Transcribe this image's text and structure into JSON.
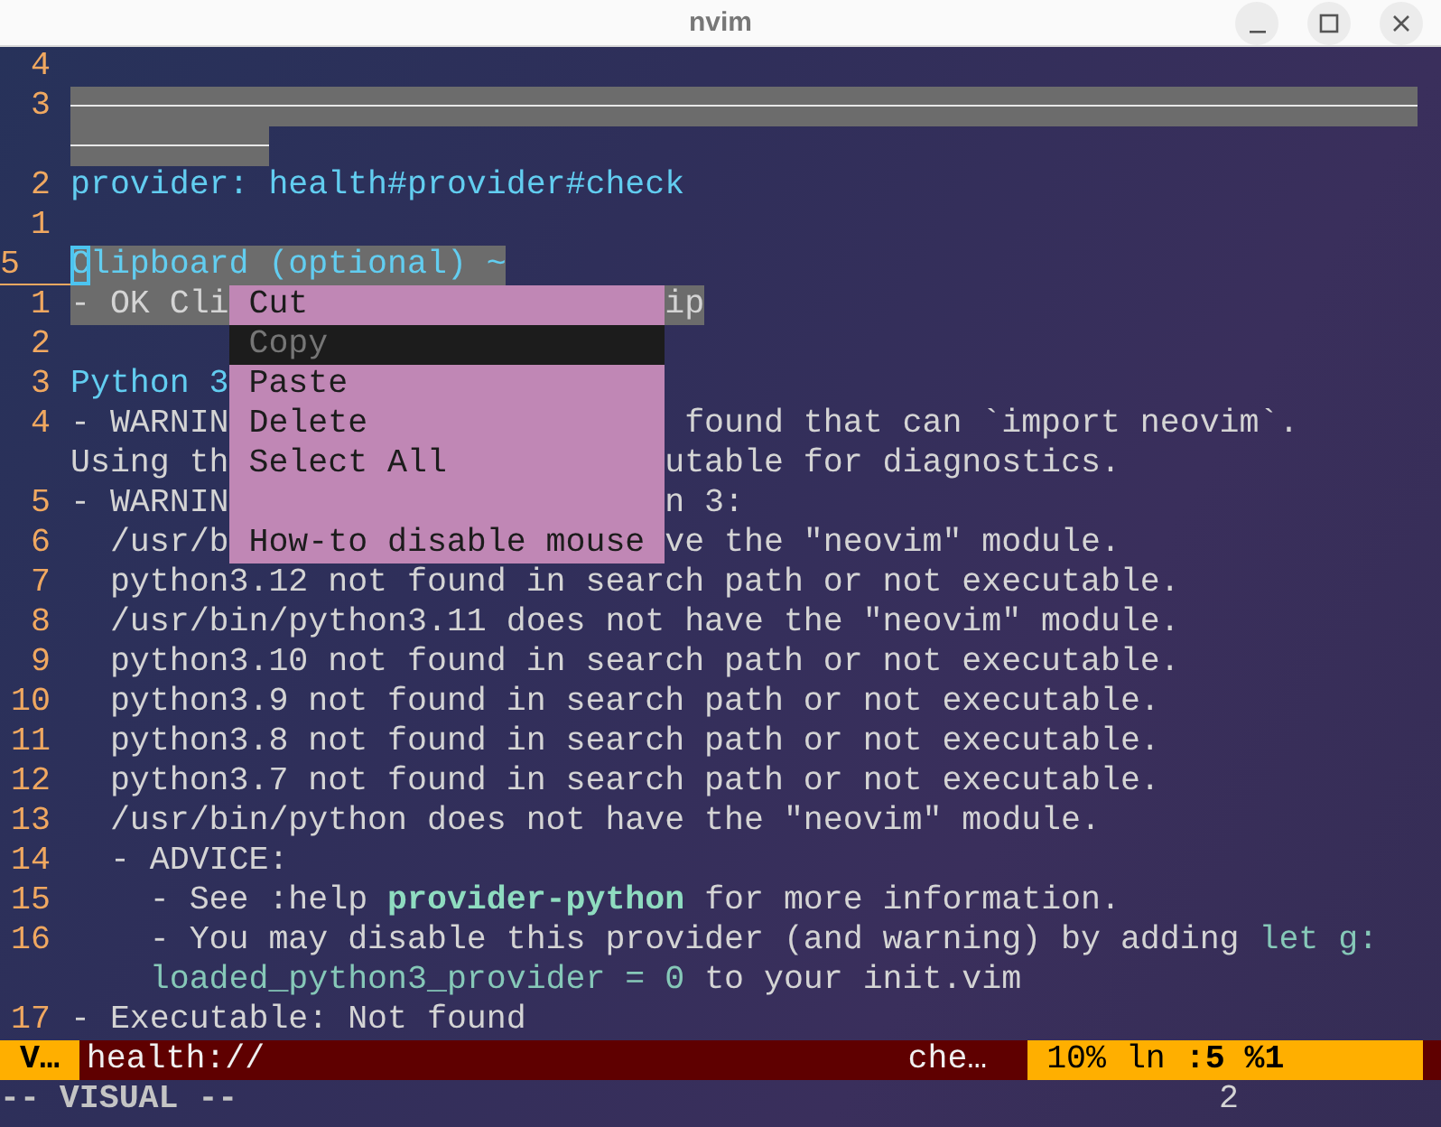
{
  "window": {
    "title": "nvim"
  },
  "lines": [
    {
      "num": "4"
    },
    {
      "num": "3",
      "kind": "rule",
      "selected": true
    },
    {
      "num": "2",
      "parts": [
        {
          "text": "provider: health#provider#check",
          "kind": "heading"
        }
      ]
    },
    {
      "num": "1"
    },
    {
      "num": "5",
      "current": true,
      "cursor": true,
      "selected": true,
      "parts": [
        {
          "text": "Clipboard (optional) ~",
          "kind": "heading"
        }
      ]
    },
    {
      "num": "1",
      "selected": true,
      "parts": [
        {
          "text": "- OK Cli",
          "kind": "plain"
        }
      ],
      "tail": [
        {
          "text": "ip",
          "kind": "plain"
        }
      ]
    },
    {
      "num": "2"
    },
    {
      "num": "3",
      "parts": [
        {
          "text": "Python 3",
          "kind": "heading"
        }
      ]
    },
    {
      "num": "4",
      "parts": [
        {
          "text": "- WARNIN",
          "kind": "plain"
        }
      ],
      "tail": [
        {
          "text": " found that can `import neovim`.",
          "kind": "plain"
        }
      ]
    },
    {
      "parts": [
        {
          "text": "Using th",
          "kind": "plain"
        }
      ],
      "tail": [
        {
          "text": "utable for diagnostics.",
          "kind": "plain"
        }
      ]
    },
    {
      "num": "5",
      "parts": [
        {
          "text": "- WARNIN",
          "kind": "plain"
        }
      ],
      "tail": [
        {
          "text": "n 3:",
          "kind": "plain"
        }
      ]
    },
    {
      "num": "6",
      "parts": [
        {
          "text": "  /usr/b",
          "kind": "plain"
        }
      ],
      "tail": [
        {
          "text": "ve the \"neovim\" module.",
          "kind": "plain"
        }
      ]
    },
    {
      "num": "7",
      "parts": [
        {
          "text": "  python3.12 not found in search path or not executable.",
          "kind": "plain"
        }
      ]
    },
    {
      "num": "8",
      "parts": [
        {
          "text": "  /usr/bin/python3.11 does not have the \"neovim\" module.",
          "kind": "plain"
        }
      ]
    },
    {
      "num": "9",
      "parts": [
        {
          "text": "  python3.10 not found in search path or not executable.",
          "kind": "plain"
        }
      ]
    },
    {
      "num": "10",
      "parts": [
        {
          "text": "  python3.9 not found in search path or not executable.",
          "kind": "plain"
        }
      ]
    },
    {
      "num": "11",
      "parts": [
        {
          "text": "  python3.8 not found in search path or not executable.",
          "kind": "plain"
        }
      ]
    },
    {
      "num": "12",
      "parts": [
        {
          "text": "  python3.7 not found in search path or not executable.",
          "kind": "plain"
        }
      ]
    },
    {
      "num": "13",
      "parts": [
        {
          "text": "  /usr/bin/python does not have the \"neovim\" module.",
          "kind": "plain"
        }
      ]
    },
    {
      "num": "14",
      "parts": [
        {
          "text": "  - ADVICE:",
          "kind": "plain"
        }
      ]
    },
    {
      "num": "15",
      "parts": [
        {
          "text": "    - See :help ",
          "kind": "plain"
        },
        {
          "text": "provider-python",
          "kind": "keyword"
        },
        {
          "text": " for more information.",
          "kind": "plain"
        }
      ]
    },
    {
      "num": "16",
      "parts": [
        {
          "text": "    - You may disable this provider (and warning) by adding ",
          "kind": "plain"
        },
        {
          "text": "let g:",
          "kind": "code"
        }
      ]
    },
    {
      "parts": [
        {
          "text": "    loaded_python3_provider = 0",
          "kind": "code"
        },
        {
          "text": " to your init.vim",
          "kind": "plain"
        }
      ]
    },
    {
      "num": "17",
      "parts": [
        {
          "text": "- Executable: Not found",
          "kind": "plain"
        }
      ]
    }
  ],
  "popup_menu": [
    {
      "kind": "item",
      "label": "Cut",
      "selected": false
    },
    {
      "kind": "item",
      "label": "Copy",
      "selected": true
    },
    {
      "kind": "item",
      "label": "Paste",
      "selected": false
    },
    {
      "kind": "item",
      "label": "Delete",
      "selected": false
    },
    {
      "kind": "item",
      "label": "Select All",
      "selected": false
    },
    {
      "kind": "separator"
    },
    {
      "kind": "item",
      "label": "How-to disable mouse",
      "selected": false
    }
  ],
  "status_bar": {
    "mode": "V…",
    "file": "health://",
    "filetype": "che…",
    "position": "10% ln **:5 %1**"
  },
  "command_line": {
    "mode": "-- VISUAL --",
    "showcmd": "2"
  }
}
